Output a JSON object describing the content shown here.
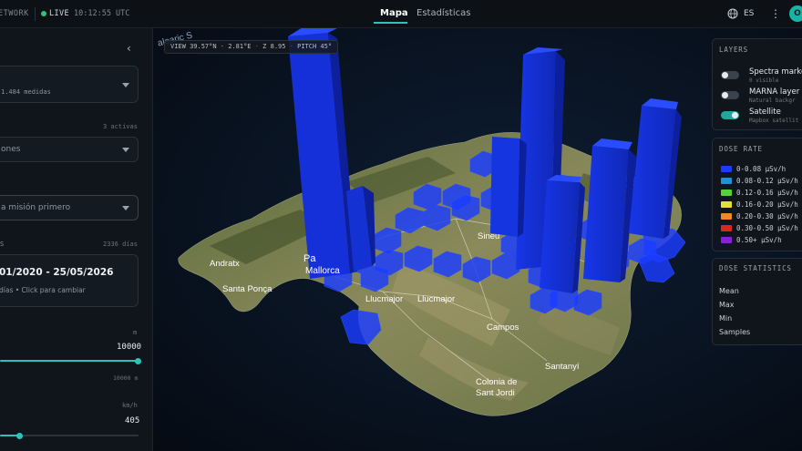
{
  "header": {
    "brand": "ETWORK",
    "live": "LIVE",
    "clock": "10:12:55 UTC",
    "tabs": [
      {
        "label": "Mapa",
        "active": true
      },
      {
        "label": "Estadísticas",
        "active": false
      }
    ],
    "language": "ES",
    "avatar_initial": "O"
  },
  "sidebar": {
    "dataset": {
      "sub": "1.484 medidas"
    },
    "sensors": {
      "count": "3 activas",
      "value": "ones"
    },
    "mission": {
      "placeholder": "a misión primero"
    },
    "range": {
      "label_suffix": "S",
      "days": "2336 días",
      "dates": "01/2020 - 25/05/2026",
      "hint": "días • Click para cambiar"
    },
    "altitude": {
      "unit": "m",
      "value": "10000",
      "max": "10000 m",
      "fraction": 1.0
    },
    "speed": {
      "unit": "km/h",
      "value": "405",
      "fraction": 0.14
    }
  },
  "map": {
    "view": "VIEW 39.57°N · 2.81°E",
    "zoom": "Z 8.95",
    "pitch": "PITCH 45°",
    "labels": {
      "sea": "alearic S",
      "andratx": "Andratx",
      "palma": "Pa",
      "mallorca": "Mallorca",
      "santa_ponca": "Santa Ponça",
      "sineu": "Sineu",
      "llucmajor1": "Llucmajor",
      "llucmajor2": "Llucmajor",
      "campos": "Campos",
      "santanyi": "Santanyí",
      "colonia1": "Colonia de",
      "colonia2": "Sant Jordi"
    }
  },
  "layers": {
    "title": "LAYERS",
    "items": [
      {
        "name": "Spectra marker",
        "sub": "0 visible",
        "on": false
      },
      {
        "name": "MARNA layer",
        "sub": "Natural backgr",
        "on": false
      },
      {
        "name": "Satellite",
        "sub": "Mapbox satellit",
        "on": true
      }
    ]
  },
  "dose_rate": {
    "title": "DOSE RATE",
    "items": [
      {
        "label": "0-0.08 µSv/h",
        "color": "#1a3cff"
      },
      {
        "label": "0.08-0.12 µSv/h",
        "color": "#1f8fd6"
      },
      {
        "label": "0.12-0.16 µSv/h",
        "color": "#55d23a"
      },
      {
        "label": "0.16-0.20 µSv/h",
        "color": "#e6e22a"
      },
      {
        "label": "0.20-0.30 µSv/h",
        "color": "#f08a1e"
      },
      {
        "label": "0.30-0.50 µSv/h",
        "color": "#e02424"
      },
      {
        "label": "0.50+ µSv/h",
        "color": "#8a1fd8"
      }
    ]
  },
  "dose_stats": {
    "title": "DOSE STATISTICS",
    "labels": [
      "Mean",
      "Max",
      "Min",
      "Samples"
    ]
  },
  "colors": {
    "accent": "#2ec2b8",
    "hexbin": "#1a3cff",
    "live": "#2ec27e"
  }
}
